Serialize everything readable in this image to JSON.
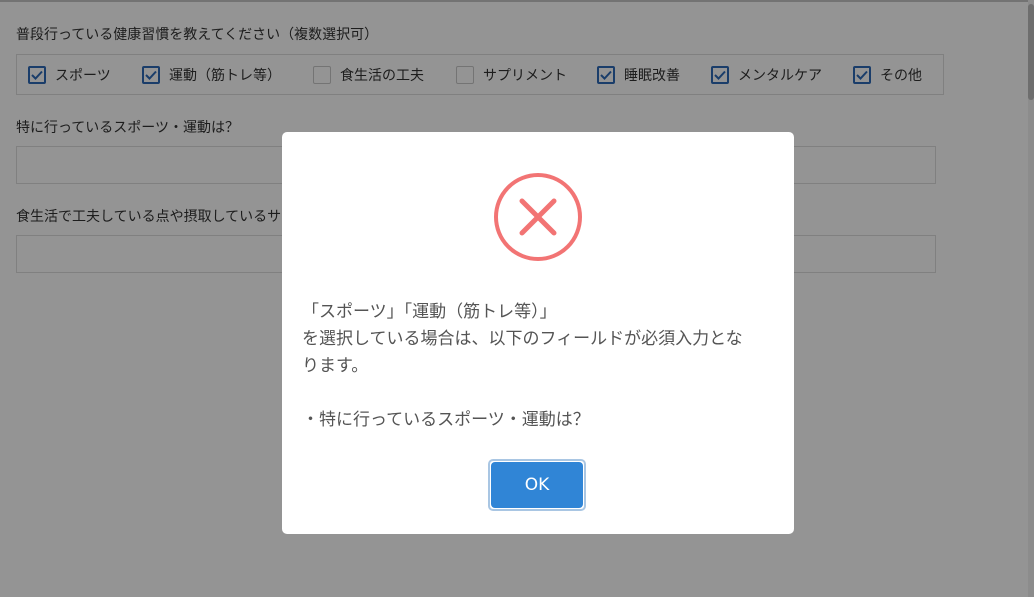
{
  "form": {
    "q1": {
      "label": "普段行っている健康習慣を教えてください（複数選択可）",
      "options": [
        {
          "label": "スポーツ",
          "checked": true
        },
        {
          "label": "運動（筋トレ等）",
          "checked": true
        },
        {
          "label": "食生活の工夫",
          "checked": false
        },
        {
          "label": "サプリメント",
          "checked": false
        },
        {
          "label": "睡眠改善",
          "checked": true
        },
        {
          "label": "メンタルケア",
          "checked": true
        },
        {
          "label": "その他",
          "checked": true
        }
      ]
    },
    "q2": {
      "label": "特に行っているスポーツ・運動は？",
      "value": ""
    },
    "q3": {
      "label": "食生活で工夫している点や摂取しているサプリメントは？",
      "value": ""
    }
  },
  "dialog": {
    "icon": "error-x-icon",
    "icon_color": "#f27474",
    "message_lines": [
      "「スポーツ」「運動（筋トレ等）」",
      "を選択している場合は、以下のフィールドが必須入力とな",
      "ります。",
      "",
      "・特に行っているスポーツ・運動は？"
    ],
    "ok_label": "OK",
    "ok_color": "#3085d6"
  },
  "colors": {
    "checkbox_accent": "#2e6ab7",
    "overlay": "rgba(0,0,0,0.42)"
  }
}
